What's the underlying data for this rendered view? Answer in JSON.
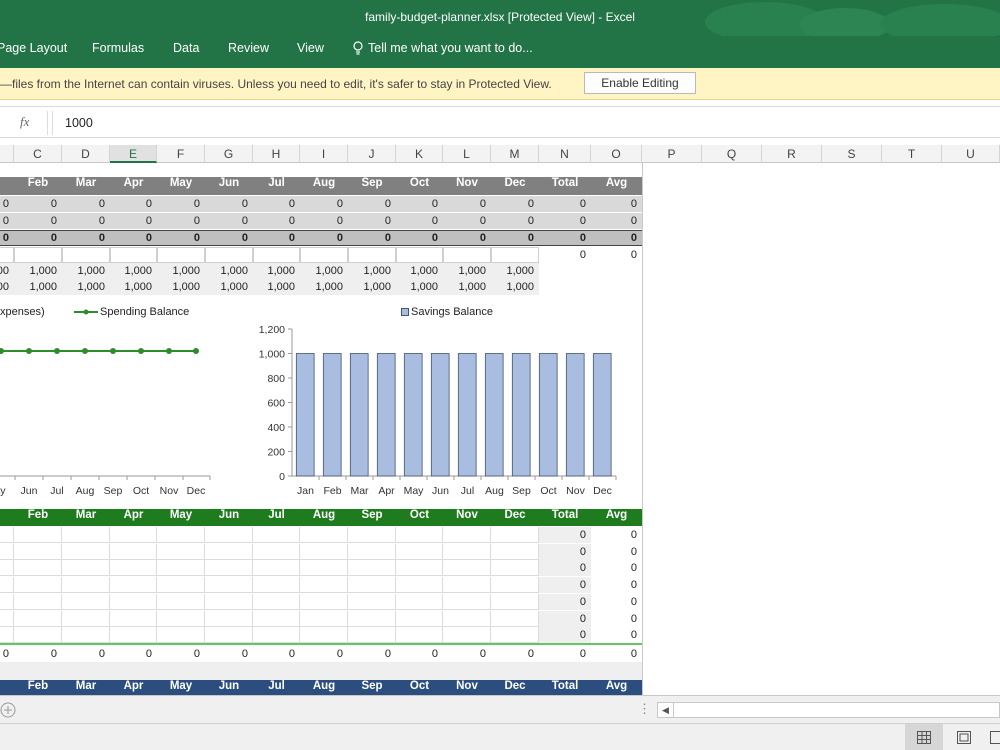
{
  "window": {
    "title": "family-budget-planner.xlsx  [Protected View] - Excel"
  },
  "ribbon": {
    "tabs": [
      "Page Layout",
      "Formulas",
      "Data",
      "Review",
      "View"
    ],
    "tell_me": "Tell me what you want to do..."
  },
  "protected_view": {
    "message": "—files from the Internet can contain viruses. Unless you need to edit, it's safer to stay in Protected View.",
    "enable_button": "Enable Editing"
  },
  "formula_bar": {
    "fx": "fx",
    "value": "1000"
  },
  "columns": [
    "C",
    "D",
    "E",
    "F",
    "G",
    "H",
    "I",
    "J",
    "K",
    "L",
    "M",
    "N",
    "O",
    "P",
    "Q",
    "R",
    "S",
    "T",
    "U"
  ],
  "selected_column": "E",
  "months_header": [
    "Feb",
    "Mar",
    "Apr",
    "May",
    "Jun",
    "Jul",
    "Aug",
    "Sep",
    "Oct",
    "Nov",
    "Dec",
    "Total",
    "Avg"
  ],
  "top_table": {
    "header_partial": "n",
    "rows": [
      [
        "0",
        "0",
        "0",
        "0",
        "0",
        "0",
        "0",
        "0",
        "0",
        "0",
        "0",
        "0",
        "0",
        "0"
      ],
      [
        "0",
        "0",
        "0",
        "0",
        "0",
        "0",
        "0",
        "0",
        "0",
        "0",
        "0",
        "0",
        "0",
        "0"
      ],
      [
        "0",
        "0",
        "0",
        "0",
        "0",
        "0",
        "0",
        "0",
        "0",
        "0",
        "0",
        "0",
        "0",
        "0"
      ],
      [
        "",
        "",
        "",
        "",
        "",
        "",
        "",
        "",
        "",
        "",
        "",
        "",
        "0",
        "0"
      ],
      [
        "00",
        "1,000",
        "1,000",
        "1,000",
        "1,000",
        "1,000",
        "1,000",
        "1,000",
        "1,000",
        "1,000",
        "1,000",
        "1,000",
        "",
        ""
      ],
      [
        "00",
        "1,000",
        "1,000",
        "1,000",
        "1,000",
        "1,000",
        "1,000",
        "1,000",
        "1,000",
        "1,000",
        "1,000",
        "1,000",
        "",
        ""
      ]
    ]
  },
  "chart_data": [
    {
      "type": "line",
      "legend_partial": "xpenses)",
      "series": [
        {
          "name": "Spending Balance",
          "values": [
            0,
            0,
            0,
            0,
            0,
            0,
            0,
            0
          ]
        }
      ],
      "categories": [
        "ay",
        "Jun",
        "Jul",
        "Aug",
        "Sep",
        "Oct",
        "Nov",
        "Dec"
      ]
    },
    {
      "type": "bar",
      "series": [
        {
          "name": "Savings Balance",
          "values": [
            1000,
            1000,
            1000,
            1000,
            1000,
            1000,
            1000,
            1000,
            1000,
            1000,
            1000,
            1000
          ]
        }
      ],
      "categories": [
        "Jan",
        "Feb",
        "Mar",
        "Apr",
        "May",
        "Jun",
        "Jul",
        "Aug",
        "Sep",
        "Oct",
        "Nov",
        "Dec"
      ],
      "ylim": [
        0,
        1200
      ],
      "yticks": [
        "0",
        "200",
        "400",
        "600",
        "800",
        "1,000",
        "1,200"
      ]
    }
  ],
  "income_table": {
    "header_partial": "n",
    "rows": [
      [
        "0",
        "0"
      ],
      [
        "0",
        "0"
      ],
      [
        "0",
        "0"
      ],
      [
        "0",
        "0"
      ],
      [
        "0",
        "0"
      ],
      [
        "0",
        "0"
      ],
      [
        "0",
        "0"
      ]
    ],
    "totals": [
      "0",
      "0",
      "0",
      "0",
      "0",
      "0",
      "0",
      "0",
      "0",
      "0",
      "0",
      "0",
      "0",
      "0"
    ]
  },
  "expense_table": {
    "header_partial": "n"
  },
  "colors": {
    "excel_green": "#227447",
    "top_header": "#808080",
    "income_header": "#1e7b1e",
    "expense_header": "#2c4e7e",
    "bar_fill": "#a9bde0",
    "line": "#2e8b2e"
  }
}
